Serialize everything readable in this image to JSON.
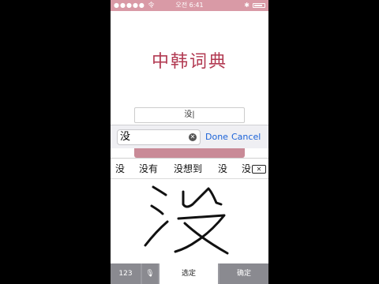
{
  "status_bar": {
    "carrier": "●●●●● 令",
    "time": "오전 6:41",
    "bluetooth": "✱"
  },
  "app": {
    "title": "中韩词典"
  },
  "query_field": {
    "value": "没|"
  },
  "search_bar": {
    "input_value": "没",
    "clear_icon": "✕",
    "done_label": "Done",
    "cancel_label": "Cancel"
  },
  "keyboard": {
    "candidates": [
      "没",
      "没有",
      "没想到",
      "没",
      "没"
    ],
    "delete_icon": "✕",
    "bottom": {
      "numbers_label": "123",
      "mic_icon": "🎙",
      "select_label": "选定",
      "confirm_label": "确定"
    }
  }
}
